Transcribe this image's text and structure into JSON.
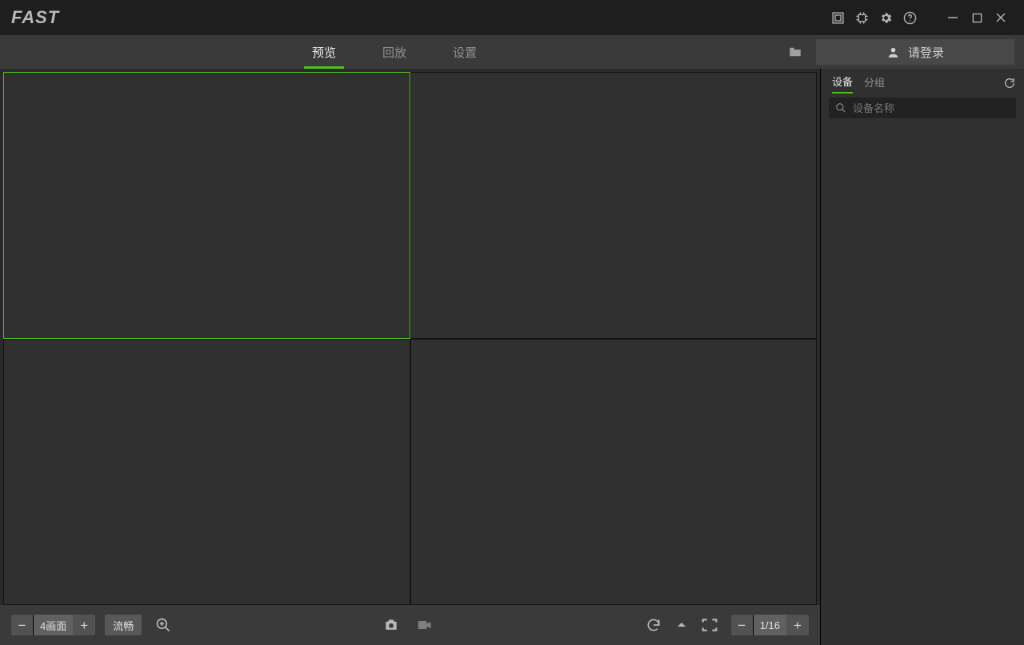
{
  "app": {
    "logo_text": "FAST"
  },
  "titlebar_icons": {
    "screenshot": "screenshot-icon",
    "record": "record-icon",
    "settings": "gear-icon",
    "help": "help-icon",
    "minimize": "minimize-icon",
    "maximize": "maximize-icon",
    "close": "close-icon"
  },
  "tabs": {
    "preview": "预览",
    "playback": "回放",
    "settings": "设置",
    "active": "preview"
  },
  "login": {
    "label": "请登录"
  },
  "sidebar": {
    "tabs": {
      "device": "设备",
      "group": "分组",
      "active": "device"
    },
    "search_placeholder": "设备名称"
  },
  "controls": {
    "layout_label": "4画面",
    "stream_mode": "流畅",
    "page_indicator": "1/16"
  },
  "grid": {
    "rows": 2,
    "cols": 2,
    "selected_index": 0
  },
  "colors": {
    "accent": "#4fbf20"
  }
}
